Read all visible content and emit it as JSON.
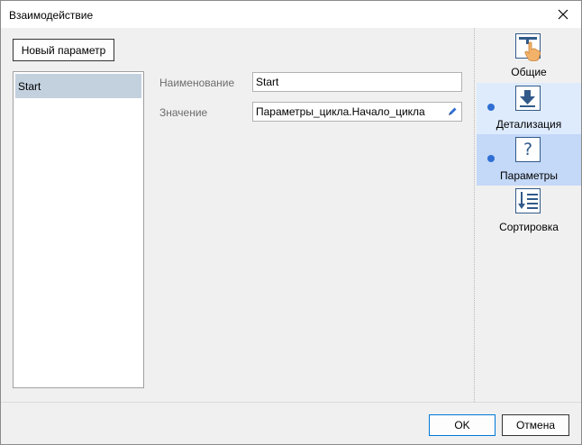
{
  "window": {
    "title": "Взаимодействие"
  },
  "toolbar": {
    "new_param_label": "Новый параметр"
  },
  "params_list": {
    "items": [
      {
        "label": "Start",
        "selected": true
      }
    ]
  },
  "form": {
    "name_label": "Наименование",
    "name_value": "Start",
    "value_label": "Значение",
    "value_value": "Параметры_цикла.Начало_цикла"
  },
  "sidebar": {
    "items": [
      {
        "label": "Общие",
        "icon": "hand-pointer-icon",
        "active": false,
        "marked": false
      },
      {
        "label": "Детализация",
        "icon": "arrow-down-icon",
        "active": false,
        "marked": true
      },
      {
        "label": "Параметры",
        "icon": "question-icon",
        "active": true,
        "marked": true
      },
      {
        "label": "Сортировка",
        "icon": "sort-icon",
        "active": false,
        "marked": false
      }
    ]
  },
  "footer": {
    "ok_label": "OK",
    "cancel_label": "Отмена"
  },
  "colors": {
    "active_side": "#c4d8f8",
    "hover_side": "#deebfd",
    "accent": "#2f6fd4",
    "icon_blue": "#315a8a",
    "selection": "#c3d0de"
  }
}
